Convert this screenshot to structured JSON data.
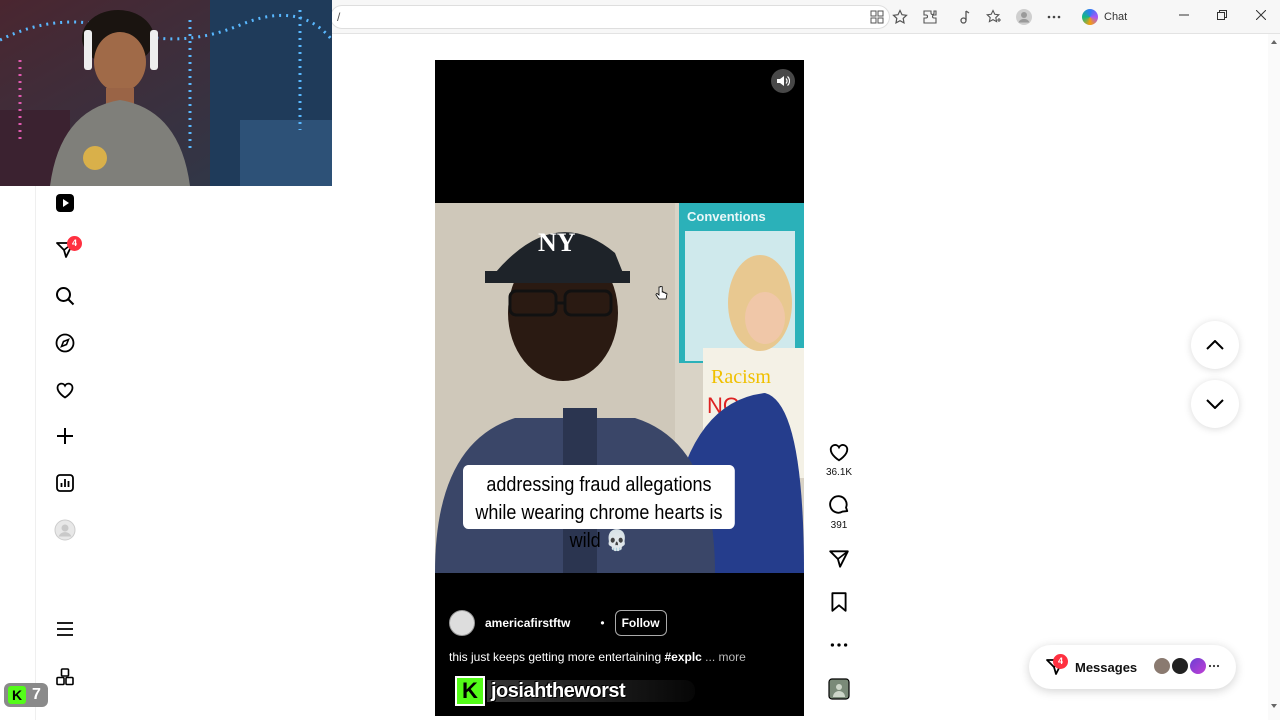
{
  "browser": {
    "address_text": "/",
    "chat_label": "Chat"
  },
  "sidebar": {
    "notifications_badge": "4",
    "kick_count": "7",
    "items": [
      {
        "icon": "reels-icon"
      },
      {
        "icon": "messages-icon"
      },
      {
        "icon": "search-icon"
      },
      {
        "icon": "explore-icon"
      },
      {
        "icon": "heart-icon"
      },
      {
        "icon": "create-icon"
      },
      {
        "icon": "dashboard-icon"
      },
      {
        "icon": "profile-avatar"
      },
      {
        "icon": "menu-icon"
      },
      {
        "icon": "also-from-meta-icon"
      }
    ]
  },
  "reel": {
    "caption_text": "addressing fraud allegations while wearing chrome hearts is wild 💀",
    "author": "americafirstftw",
    "separator": "•",
    "follow_label": "Follow",
    "description": "this just keeps getting more entertaining",
    "hashtag": "#explc",
    "more_label": "... more",
    "overlay_k": "K",
    "overlay_name": "josiahtheworst",
    "likes": "36.1K",
    "comments": "391"
  },
  "messages": {
    "label": "Messages",
    "badge": "4"
  },
  "colors": {
    "badge_red": "#ff3040",
    "kick_green": "#53fc18"
  }
}
